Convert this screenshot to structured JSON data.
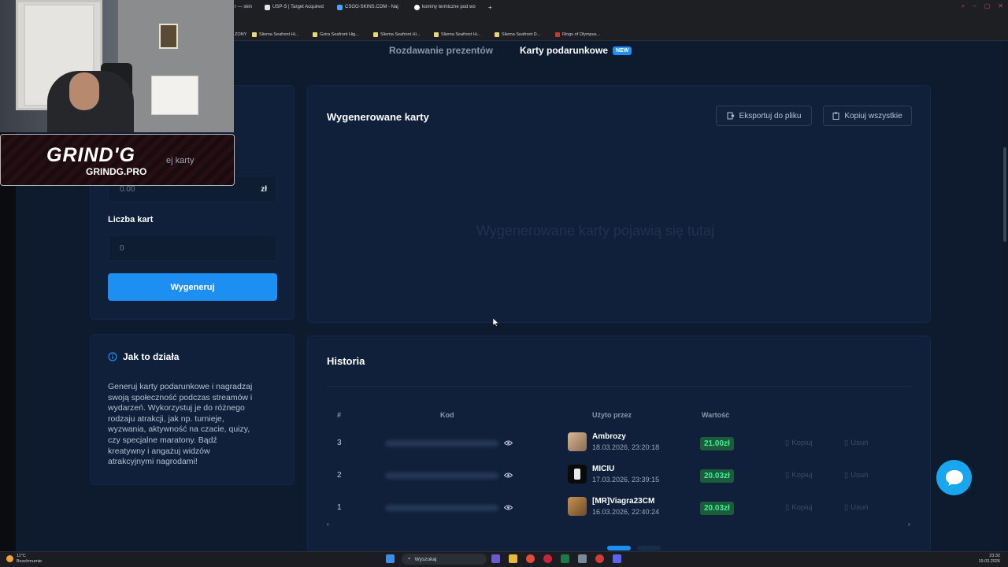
{
  "browser": {
    "tabs": [
      "r — skin",
      "USP-S | Target Acquired",
      "CSGO-SKINS.COM - Naj",
      "kominy termiczne pod wo"
    ],
    "bookmarks": [
      "ZONY",
      "Sliema Seafront Hi...",
      "Gzira Seafront Hig...",
      "Sliema Seafront Hi...",
      "Sliema Seafront Hi...",
      "Sliema Seafront D...",
      "Rings of Olympus..."
    ]
  },
  "nav": {
    "giveaways": "Rozdawanie prezentów",
    "gift_cards": "Karty podarunkowe",
    "new_badge": "NEW"
  },
  "generator": {
    "value_label_partial": "ej karty",
    "amount_value": "0.00",
    "currency": "zł",
    "count_label": "Liczba kart",
    "count_value": "0",
    "generate_button": "Wygeneruj"
  },
  "generated": {
    "title": "Wygenerowane karty",
    "export_button": "Eksportuj do pliku",
    "copy_all_button": "Kopiuj wszystkie",
    "empty_text": "Wygenerowane karty pojawią się tutaj"
  },
  "how_it_works": {
    "title": "Jak to działa",
    "lines": [
      "Generuj karty podarunkowe i nagradzaj",
      "swoją społeczność podczas streamów i",
      "wydarzeń. Wykorzystuj je do różnego",
      "rodzaju atrakcji, jak np. turnieje,",
      "wyzwania, aktywność na czacie, quizy,",
      "czy specjalne maratony. Bądź",
      "kreatywny i angażuj widzów",
      "atrakcyjnymi nagrodami!"
    ]
  },
  "history": {
    "title": "Historia",
    "columns": {
      "num": "#",
      "code": "Kod",
      "used_by": "Użyto przez",
      "value": "Wartość"
    },
    "copy_label": "Kopiuj",
    "delete_label": "Usuń",
    "rows": [
      {
        "num": "3",
        "user": "Ambrozy",
        "date": "18.03.2026, 23:20:18",
        "value": "21.00zł"
      },
      {
        "num": "2",
        "user": "MICIU",
        "date": "17.03.2026, 23:39:15",
        "value": "20.03zł"
      },
      {
        "num": "1",
        "user": "[MR]Viagra23CM",
        "date": "16.03.2026, 22:40:24",
        "value": "20.03zł"
      }
    ]
  },
  "overlay": {
    "brand": "GRIND'G",
    "brand_url": "GRINDG.PRO"
  },
  "taskbar": {
    "temp": "11°C",
    "weather": "Bezchmurnie",
    "search": "Wyszukaj",
    "time": "23:32",
    "date": "19.03.2026"
  },
  "colors": {
    "accent": "#1e8ff2",
    "value_green": "#3ff09a",
    "panel": "#10203a",
    "background": "#0e1a2e"
  }
}
